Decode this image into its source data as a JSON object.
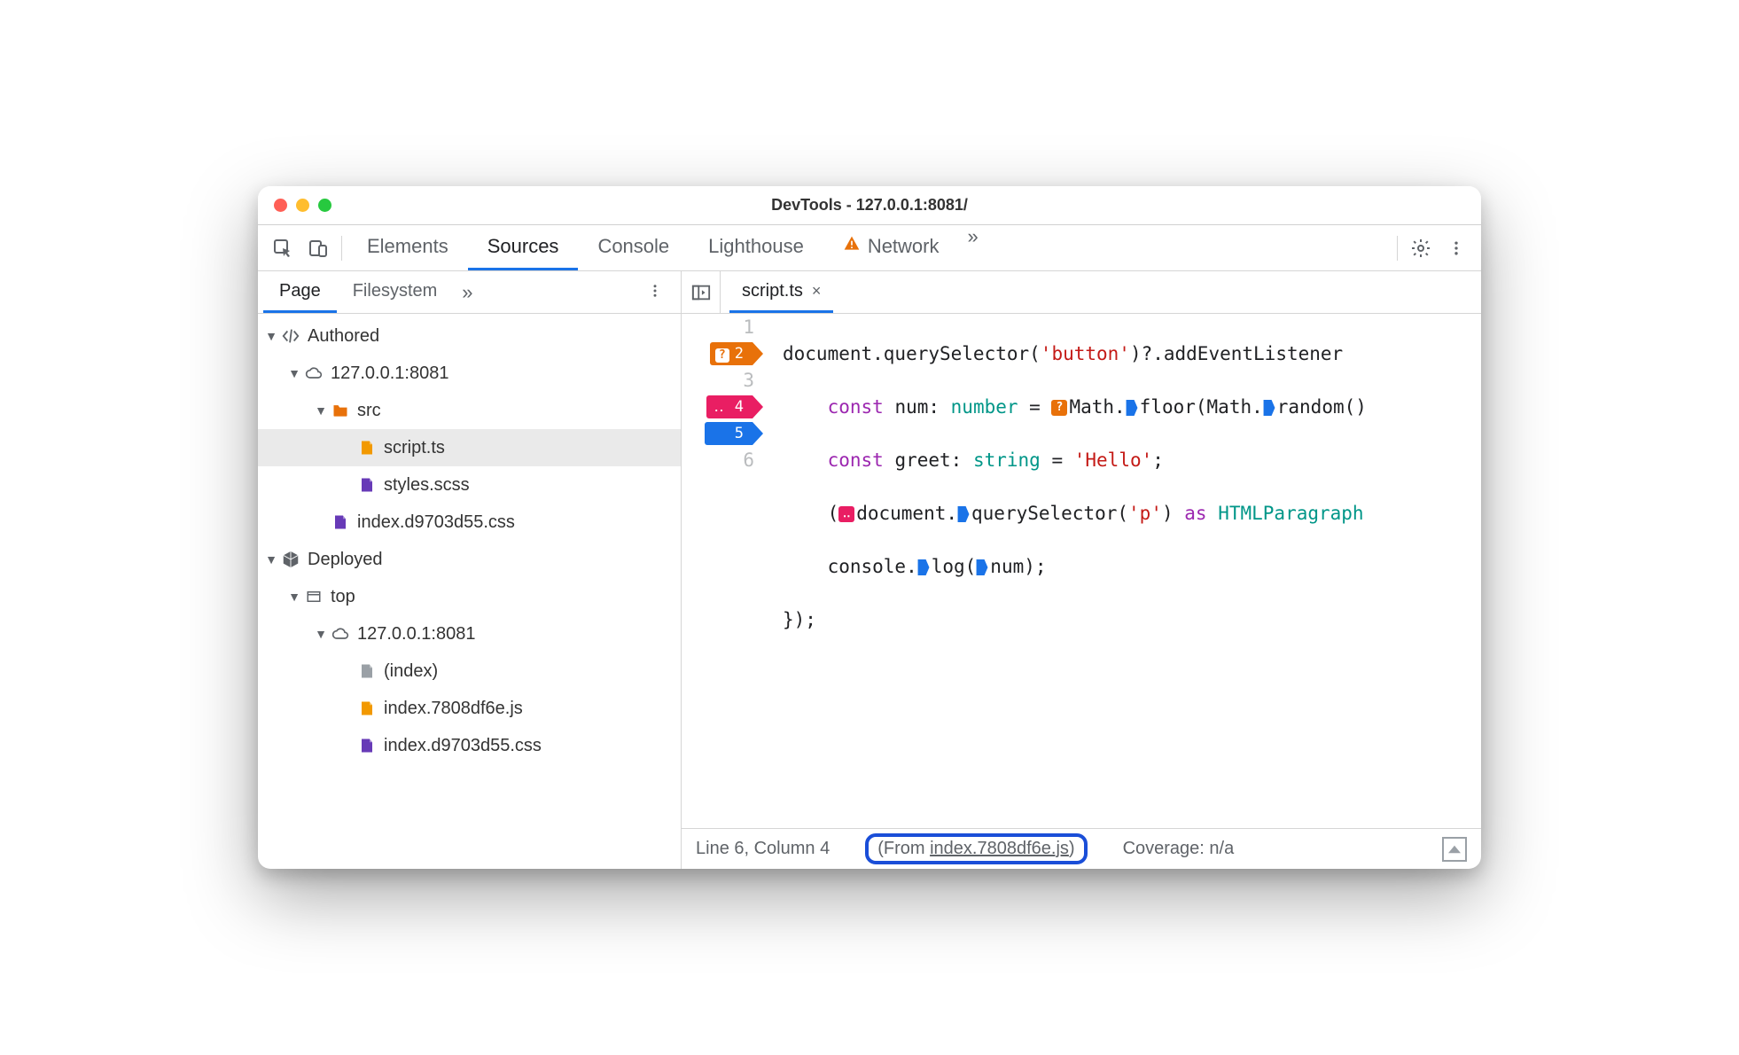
{
  "window": {
    "title": "DevTools - 127.0.0.1:8081/"
  },
  "tabs": {
    "main": [
      "Elements",
      "Sources",
      "Console",
      "Lighthouse",
      "Network"
    ],
    "active": "Sources",
    "overflow_glyph": "»"
  },
  "sidebar": {
    "tabs": [
      "Page",
      "Filesystem"
    ],
    "active": "Page",
    "overflow_glyph": "»",
    "tree": {
      "authored": {
        "label": "Authored",
        "host": "127.0.0.1:8081",
        "folder": "src",
        "files": [
          "script.ts",
          "styles.scss"
        ],
        "root_file": "index.d9703d55.css"
      },
      "deployed": {
        "label": "Deployed",
        "top": "top",
        "host": "127.0.0.1:8081",
        "files": [
          "(index)",
          "index.7808df6e.js",
          "index.d9703d55.css"
        ]
      }
    }
  },
  "editor": {
    "open_file": "script.ts",
    "close_glyph": "×",
    "lines": {
      "1": "document.querySelector('button')?.addEventListener",
      "2": "    const num: number = Math.floor(Math.random()",
      "3": "    const greet: string = 'Hello';",
      "4": "    (document.querySelector('p') as HTMLParagraph",
      "5": "    console.log(num);",
      "6": "});"
    },
    "breakpoints": {
      "2": {
        "style": "orange",
        "badge": "?"
      },
      "4": {
        "style": "pink",
        "badge": ".."
      },
      "5": {
        "style": "blue",
        "badge": ""
      }
    }
  },
  "status": {
    "cursor": "Line 6, Column 4",
    "from_prefix": "(From ",
    "from_file": "index.7808df6e.js",
    "from_suffix": ")",
    "coverage": "Coverage: n/a"
  }
}
